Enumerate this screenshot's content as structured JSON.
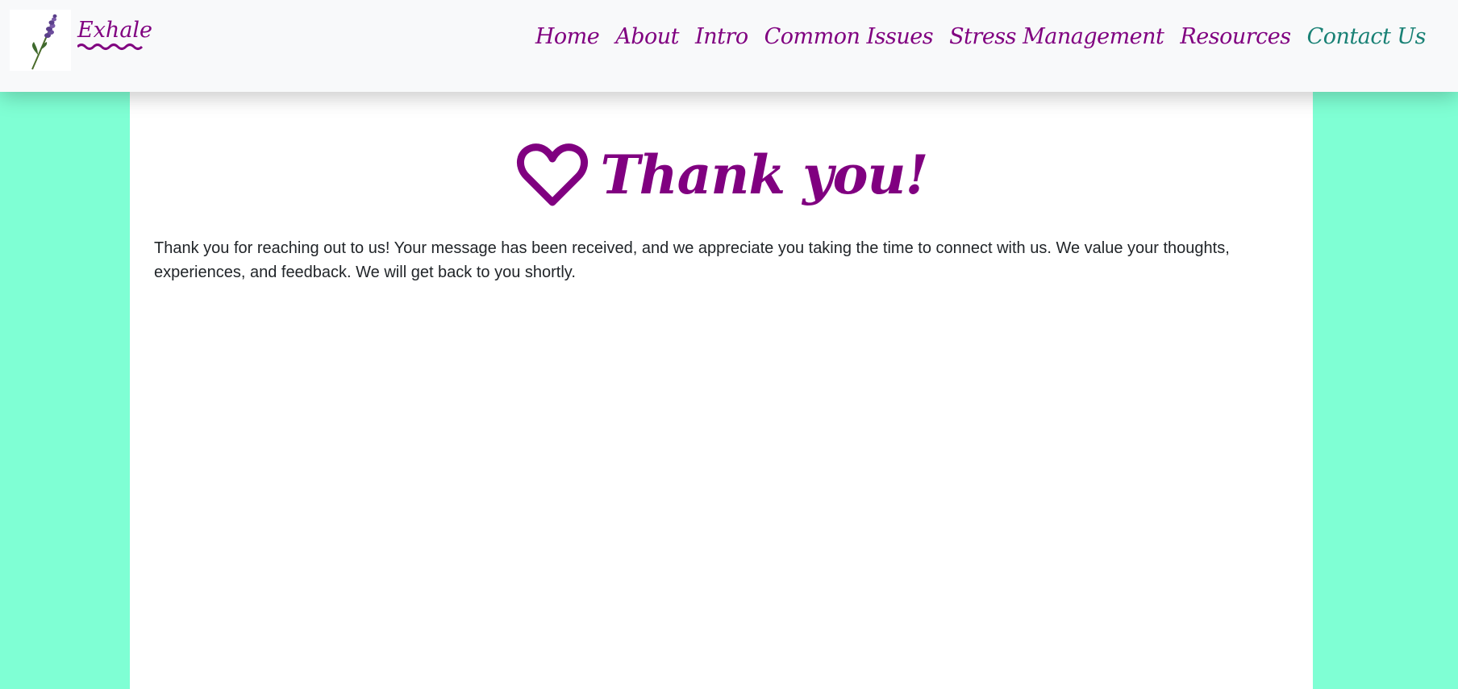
{
  "brand": {
    "name": "Exhale",
    "logo_icon": "lavender-icon"
  },
  "nav": {
    "items": [
      {
        "label": "Home"
      },
      {
        "label": "About"
      },
      {
        "label": "Intro"
      },
      {
        "label": "Common Issues"
      },
      {
        "label": "Stress Management"
      },
      {
        "label": "Resources"
      },
      {
        "label": "Contact Us",
        "active": true
      }
    ]
  },
  "main": {
    "title": "Thank you!",
    "title_icon": "heart-icon",
    "message": "Thank you for reaching out to us! Your message has been received, and we appreciate you taking the time to connect with us. We value your thoughts, experiences, and feedback. We will get back to you shortly."
  },
  "colors": {
    "page_background": "#7fffd4",
    "navbar_background": "#f8f9fa",
    "accent_purple": "#800080",
    "active_link": "#198175",
    "body_text": "#212529"
  }
}
